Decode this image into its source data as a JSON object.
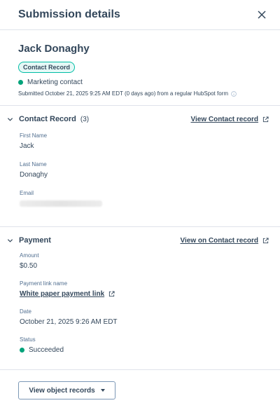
{
  "panel": {
    "title": "Submission details"
  },
  "contact": {
    "name": "Jack Donaghy",
    "badge": "Contact Record",
    "type": "Marketing contact",
    "submitted": "Submitted October 21, 2025 9:25 AM EDT (0 days ago) from a regular HubSpot form"
  },
  "contact_section": {
    "title": "Contact Record",
    "count": "(3)",
    "link": "View Contact record",
    "fields": [
      {
        "label": "First Name",
        "value": "Jack"
      },
      {
        "label": "Last Name",
        "value": "Donaghy"
      },
      {
        "label": "Email",
        "value": ""
      }
    ]
  },
  "payment_section": {
    "title": "Payment",
    "link": "View on Contact record",
    "fields": [
      {
        "label": "Amount",
        "value": "$0.50"
      },
      {
        "label": "Payment link name",
        "value": "White paper payment link"
      },
      {
        "label": "Date",
        "value": "October 21, 2025 9:26 AM EDT"
      },
      {
        "label": "Status",
        "value": "Succeeded"
      }
    ]
  },
  "footer": {
    "button": "View object records"
  },
  "colors": {
    "success": "#00a37a",
    "badge_border": "#00bda5",
    "text": "#33475b"
  }
}
